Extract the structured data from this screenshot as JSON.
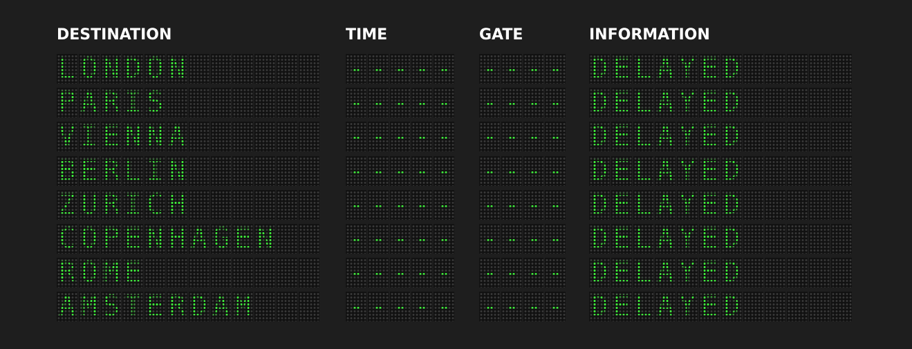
{
  "board": {
    "headers": {
      "destination": "DESTINATION",
      "time": "TIME",
      "gate": "GATE",
      "information": "INFORMATION"
    },
    "colors": {
      "background": "#1e1e1e",
      "led_on": "#3fea3b",
      "led_off": "#3a3a3a",
      "header_text": "#ffffff"
    },
    "rows": [
      {
        "destination": "LONDON",
        "time": "-----",
        "gate": "----",
        "information": "DELAYED"
      },
      {
        "destination": "PARIS",
        "time": "-----",
        "gate": "----",
        "information": "DELAYED"
      },
      {
        "destination": "VIENNA",
        "time": "-----",
        "gate": "----",
        "information": "DELAYED"
      },
      {
        "destination": "BERLIN",
        "time": "-----",
        "gate": "----",
        "information": "DELAYED"
      },
      {
        "destination": "ZURICH",
        "time": "-----",
        "gate": "----",
        "information": "DELAYED"
      },
      {
        "destination": "COPENHAGEN",
        "time": "-----",
        "gate": "----",
        "information": "DELAYED"
      },
      {
        "destination": "ROME",
        "time": "-----",
        "gate": "----",
        "information": "DELAYED"
      },
      {
        "destination": "AMSTERDAM",
        "time": "-----",
        "gate": "----",
        "information": "DELAYED"
      }
    ]
  }
}
